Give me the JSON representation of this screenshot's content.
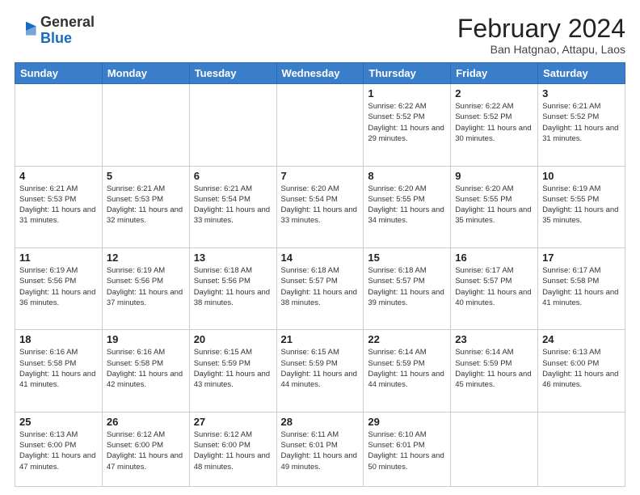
{
  "logo": {
    "general": "General",
    "blue": "Blue"
  },
  "title": "February 2024",
  "subtitle": "Ban Hatgnao, Attapu, Laos",
  "days_of_week": [
    "Sunday",
    "Monday",
    "Tuesday",
    "Wednesday",
    "Thursday",
    "Friday",
    "Saturday"
  ],
  "weeks": [
    [
      {
        "day": "",
        "sunrise": "",
        "sunset": "",
        "daylight": ""
      },
      {
        "day": "",
        "sunrise": "",
        "sunset": "",
        "daylight": ""
      },
      {
        "day": "",
        "sunrise": "",
        "sunset": "",
        "daylight": ""
      },
      {
        "day": "",
        "sunrise": "",
        "sunset": "",
        "daylight": ""
      },
      {
        "day": "1",
        "sunrise": "6:22 AM",
        "sunset": "5:52 PM",
        "daylight": "11 hours and 29 minutes."
      },
      {
        "day": "2",
        "sunrise": "6:22 AM",
        "sunset": "5:52 PM",
        "daylight": "11 hours and 30 minutes."
      },
      {
        "day": "3",
        "sunrise": "6:21 AM",
        "sunset": "5:52 PM",
        "daylight": "11 hours and 31 minutes."
      }
    ],
    [
      {
        "day": "4",
        "sunrise": "6:21 AM",
        "sunset": "5:53 PM",
        "daylight": "11 hours and 31 minutes."
      },
      {
        "day": "5",
        "sunrise": "6:21 AM",
        "sunset": "5:53 PM",
        "daylight": "11 hours and 32 minutes."
      },
      {
        "day": "6",
        "sunrise": "6:21 AM",
        "sunset": "5:54 PM",
        "daylight": "11 hours and 33 minutes."
      },
      {
        "day": "7",
        "sunrise": "6:20 AM",
        "sunset": "5:54 PM",
        "daylight": "11 hours and 33 minutes."
      },
      {
        "day": "8",
        "sunrise": "6:20 AM",
        "sunset": "5:55 PM",
        "daylight": "11 hours and 34 minutes."
      },
      {
        "day": "9",
        "sunrise": "6:20 AM",
        "sunset": "5:55 PM",
        "daylight": "11 hours and 35 minutes."
      },
      {
        "day": "10",
        "sunrise": "6:19 AM",
        "sunset": "5:55 PM",
        "daylight": "11 hours and 35 minutes."
      }
    ],
    [
      {
        "day": "11",
        "sunrise": "6:19 AM",
        "sunset": "5:56 PM",
        "daylight": "11 hours and 36 minutes."
      },
      {
        "day": "12",
        "sunrise": "6:19 AM",
        "sunset": "5:56 PM",
        "daylight": "11 hours and 37 minutes."
      },
      {
        "day": "13",
        "sunrise": "6:18 AM",
        "sunset": "5:56 PM",
        "daylight": "11 hours and 38 minutes."
      },
      {
        "day": "14",
        "sunrise": "6:18 AM",
        "sunset": "5:57 PM",
        "daylight": "11 hours and 38 minutes."
      },
      {
        "day": "15",
        "sunrise": "6:18 AM",
        "sunset": "5:57 PM",
        "daylight": "11 hours and 39 minutes."
      },
      {
        "day": "16",
        "sunrise": "6:17 AM",
        "sunset": "5:57 PM",
        "daylight": "11 hours and 40 minutes."
      },
      {
        "day": "17",
        "sunrise": "6:17 AM",
        "sunset": "5:58 PM",
        "daylight": "11 hours and 41 minutes."
      }
    ],
    [
      {
        "day": "18",
        "sunrise": "6:16 AM",
        "sunset": "5:58 PM",
        "daylight": "11 hours and 41 minutes."
      },
      {
        "day": "19",
        "sunrise": "6:16 AM",
        "sunset": "5:58 PM",
        "daylight": "11 hours and 42 minutes."
      },
      {
        "day": "20",
        "sunrise": "6:15 AM",
        "sunset": "5:59 PM",
        "daylight": "11 hours and 43 minutes."
      },
      {
        "day": "21",
        "sunrise": "6:15 AM",
        "sunset": "5:59 PM",
        "daylight": "11 hours and 44 minutes."
      },
      {
        "day": "22",
        "sunrise": "6:14 AM",
        "sunset": "5:59 PM",
        "daylight": "11 hours and 44 minutes."
      },
      {
        "day": "23",
        "sunrise": "6:14 AM",
        "sunset": "5:59 PM",
        "daylight": "11 hours and 45 minutes."
      },
      {
        "day": "24",
        "sunrise": "6:13 AM",
        "sunset": "6:00 PM",
        "daylight": "11 hours and 46 minutes."
      }
    ],
    [
      {
        "day": "25",
        "sunrise": "6:13 AM",
        "sunset": "6:00 PM",
        "daylight": "11 hours and 47 minutes."
      },
      {
        "day": "26",
        "sunrise": "6:12 AM",
        "sunset": "6:00 PM",
        "daylight": "11 hours and 47 minutes."
      },
      {
        "day": "27",
        "sunrise": "6:12 AM",
        "sunset": "6:00 PM",
        "daylight": "11 hours and 48 minutes."
      },
      {
        "day": "28",
        "sunrise": "6:11 AM",
        "sunset": "6:01 PM",
        "daylight": "11 hours and 49 minutes."
      },
      {
        "day": "29",
        "sunrise": "6:10 AM",
        "sunset": "6:01 PM",
        "daylight": "11 hours and 50 minutes."
      },
      {
        "day": "",
        "sunrise": "",
        "sunset": "",
        "daylight": ""
      },
      {
        "day": "",
        "sunrise": "",
        "sunset": "",
        "daylight": ""
      }
    ]
  ]
}
